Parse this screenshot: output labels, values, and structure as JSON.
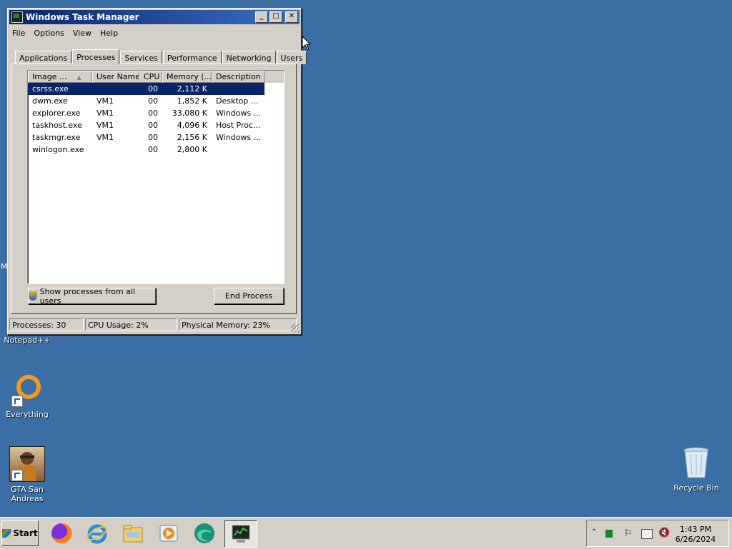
{
  "window": {
    "title": "Windows Task Manager",
    "controls": {
      "minimize": "_",
      "maximize": "□",
      "close": "✕"
    }
  },
  "menu": [
    "File",
    "Options",
    "View",
    "Help"
  ],
  "tabs": [
    {
      "label": "Applications",
      "active": false
    },
    {
      "label": "Processes",
      "active": true
    },
    {
      "label": "Services",
      "active": false
    },
    {
      "label": "Performance",
      "active": false
    },
    {
      "label": "Networking",
      "active": false
    },
    {
      "label": "Users",
      "active": false
    }
  ],
  "process_table": {
    "columns": [
      "Image ...",
      "User Name",
      "CPU",
      "Memory (...",
      "Description"
    ],
    "rows": [
      {
        "image": "csrss.exe",
        "user": "",
        "cpu": "00",
        "memory": "2,112 K",
        "description": "",
        "selected": true
      },
      {
        "image": "dwm.exe",
        "user": "VM1",
        "cpu": "00",
        "memory": "1,852 K",
        "description": "Desktop ..."
      },
      {
        "image": "explorer.exe",
        "user": "VM1",
        "cpu": "00",
        "memory": "33,080 K",
        "description": "Windows ..."
      },
      {
        "image": "taskhost.exe",
        "user": "VM1",
        "cpu": "00",
        "memory": "4,096 K",
        "description": "Host Proc..."
      },
      {
        "image": "taskmgr.exe",
        "user": "VM1",
        "cpu": "00",
        "memory": "2,156 K",
        "description": "Windows ..."
      },
      {
        "image": "winlogon.exe",
        "user": "",
        "cpu": "00",
        "memory": "2,800 K",
        "description": ""
      }
    ]
  },
  "buttons": {
    "show_all": "Show processes from all users",
    "end_process": "End Process"
  },
  "status": {
    "processes": "Processes: 30",
    "cpu": "CPU Usage: 2%",
    "memory": "Physical Memory: 23%"
  },
  "desktop": {
    "side_letter": "M",
    "icons": [
      {
        "label": "Notepad++",
        "icon": "notepadpp-icon"
      },
      {
        "label": "Everything",
        "icon": "everything-icon"
      },
      {
        "label": "GTA San Andreas",
        "icon": "gta-icon"
      },
      {
        "label": "Recycle Bin",
        "icon": "recycle-bin-icon"
      }
    ]
  },
  "taskbar": {
    "start_label": "Start",
    "pinned": [
      "firefox-icon",
      "internet-explorer-icon",
      "file-explorer-icon",
      "media-player-icon",
      "edge-icon",
      "task-manager-icon"
    ],
    "clock_time": "1:43 PM",
    "clock_date": "6/26/2024"
  },
  "colors": {
    "desktop": "#3a6ea5",
    "title_bar": "#0a246a",
    "selection": "#0a246a"
  }
}
